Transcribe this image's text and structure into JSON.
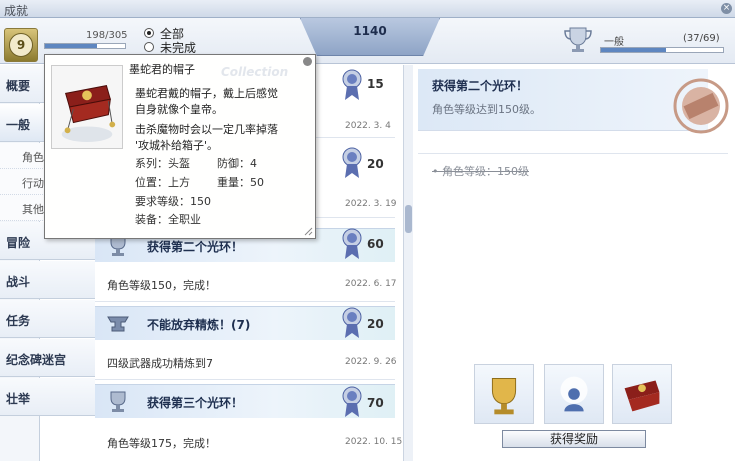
{
  "window": {
    "title": "成就"
  },
  "header": {
    "level": "9",
    "exp_text": "198/305",
    "exp_fraction": 0.65,
    "filter_all": "全部",
    "filter_incomplete": "未完成",
    "score": "1140",
    "rank_label": "一般",
    "rank_count": "(37/69)",
    "rank_fraction": 0.53
  },
  "sidebar": {
    "items": [
      {
        "label": "概要"
      },
      {
        "label": "一般"
      },
      {
        "label": "角色"
      },
      {
        "label": "行动"
      },
      {
        "label": "其他"
      },
      {
        "label": "冒险"
      },
      {
        "label": "战斗"
      },
      {
        "label": "任务"
      },
      {
        "label": "纪念碑迷宫"
      },
      {
        "label": "壮举"
      }
    ]
  },
  "list": {
    "rows": [
      {
        "name": "",
        "points": "15",
        "desc": "",
        "date": "2022. 3. 4"
      },
      {
        "name": "",
        "points": "20",
        "desc": "",
        "date": "2022. 3. 19"
      },
      {
        "name": "获得第二个光环！",
        "points": "60",
        "desc": "角色等级150，完成！",
        "date": "2022. 6. 17"
      },
      {
        "name": "不能放弃精炼！(7)",
        "points": "20",
        "desc": "四级武器成功精炼到7",
        "date": "2022. 9. 26"
      },
      {
        "name": "获得第三个光环！",
        "points": "70",
        "desc": "角色等级175，完成！",
        "date": "2022. 10. 15"
      }
    ]
  },
  "tooltip": {
    "name": "墨蛇君的帽子",
    "watermark": "Collection",
    "desc_lines": [
      "墨蛇君戴的帽子，戴上后感觉",
      "自身就像个皇帝。",
      "击杀魔物时会以一定几率掉落",
      "'攻城补给箱子'。"
    ],
    "type_label": "系列：头盔",
    "def_label": "防御：4",
    "pos_label": "位置：上方",
    "weight_label": "重量：50",
    "req_level_label": "要求等级：150",
    "equip_label": "装备：全职业"
  },
  "detail": {
    "title": "获得第二个光环！",
    "desc": "角色等级达到150级。",
    "condition": "角色等级：150级",
    "claim_button": "获得奖励"
  }
}
